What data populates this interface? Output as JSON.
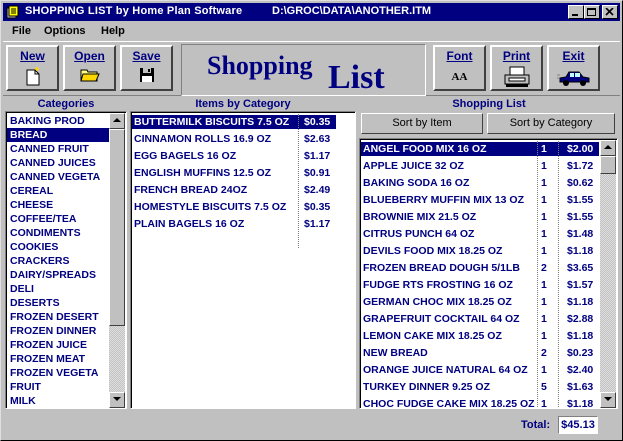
{
  "window": {
    "title": "SHOPPING LIST by Home Plan Software",
    "path": "D:\\GROC\\DATA\\ANOTHER.ITM"
  },
  "menu": [
    "File",
    "Options",
    "Help"
  ],
  "toolbar": {
    "new_label": "New",
    "open_label": "Open",
    "save_label": "Save",
    "font_label": "Font",
    "print_label": "Print",
    "exit_label": "Exit",
    "font_icon_text": "AA",
    "banner_word1": "Shopping",
    "banner_word2": "List"
  },
  "categories": {
    "title": "Categories",
    "selected_index": 1,
    "items": [
      "BAKING PROD",
      "BREAD",
      "CANNED FRUIT",
      "CANNED JUICES",
      "CANNED VEGETA",
      "CEREAL",
      "CHEESE",
      "COFFEE/TEA",
      "CONDIMENTS",
      "COOKIES",
      "CRACKERS",
      "DAIRY/SPREADS",
      "DELI",
      "DESERTS",
      "FROZEN DESERT",
      "FROZEN DINNER",
      "FROZEN JUICE",
      "FROZEN MEAT",
      "FROZEN VEGETA",
      "FRUIT",
      "MILK"
    ]
  },
  "items_by_category": {
    "title": "Items by Category",
    "selected_index": 0,
    "rows": [
      {
        "name": "BUTTERMILK BISCUITS 7.5 OZ",
        "price": "$0.35"
      },
      {
        "name": "CINNAMON ROLLS 16.9 OZ",
        "price": "$2.63"
      },
      {
        "name": "EGG BAGELS 16 OZ",
        "price": "$1.17"
      },
      {
        "name": "ENGLISH MUFFINS 12.5 OZ",
        "price": "$0.91"
      },
      {
        "name": "FRENCH BREAD 24OZ",
        "price": "$2.49"
      },
      {
        "name": "HOMESTYLE BISCUITS 7.5 OZ",
        "price": "$0.35"
      },
      {
        "name": "PLAIN BAGELS 16 OZ",
        "price": "$1.17"
      }
    ]
  },
  "shopping_list": {
    "title": "Shopping List",
    "sort_by_item_label": "Sort by Item",
    "sort_by_category_label": "Sort by Category",
    "selected_index": 0,
    "rows": [
      {
        "name": "ANGEL FOOD MIX 16 OZ",
        "qty": "1",
        "price": "$2.00"
      },
      {
        "name": "APPLE JUICE 32 OZ",
        "qty": "1",
        "price": "$1.72"
      },
      {
        "name": "BAKING SODA 16 OZ",
        "qty": "1",
        "price": "$0.62"
      },
      {
        "name": "BLUEBERRY MUFFIN MIX 13 OZ",
        "qty": "1",
        "price": "$1.55"
      },
      {
        "name": "BROWNIE MIX 21.5 OZ",
        "qty": "1",
        "price": "$1.55"
      },
      {
        "name": "CITRUS PUNCH 64 OZ",
        "qty": "1",
        "price": "$1.48"
      },
      {
        "name": "DEVILS FOOD MIX 18.25 OZ",
        "qty": "1",
        "price": "$1.18"
      },
      {
        "name": "FROZEN BREAD DOUGH 5/1LB",
        "qty": "2",
        "price": "$3.65"
      },
      {
        "name": "FUDGE RTS FROSTING 16 OZ",
        "qty": "1",
        "price": "$1.57"
      },
      {
        "name": "GERMAN CHOC MIX 18.25 OZ",
        "qty": "1",
        "price": "$1.18"
      },
      {
        "name": "GRAPEFRUIT COCKTAIL 64 OZ",
        "qty": "1",
        "price": "$2.88"
      },
      {
        "name": "LEMON CAKE MIX 18.25 OZ",
        "qty": "1",
        "price": "$1.18"
      },
      {
        "name": "NEW BREAD",
        "qty": "2",
        "price": "$0.23"
      },
      {
        "name": "ORANGE JUICE NATURAL 64 OZ",
        "qty": "1",
        "price": "$2.40"
      },
      {
        "name": "TURKEY DINNER 9.25 OZ",
        "qty": "5",
        "price": "$1.63"
      },
      {
        "name": "CHOC FUDGE CAKE MIX 18.25 OZ",
        "qty": "1",
        "price": "$1.18"
      }
    ]
  },
  "status": {
    "total_label": "Total:",
    "total_value": "$45.13"
  },
  "colors": {
    "accent": "#000080",
    "face": "#c0c0c0"
  }
}
